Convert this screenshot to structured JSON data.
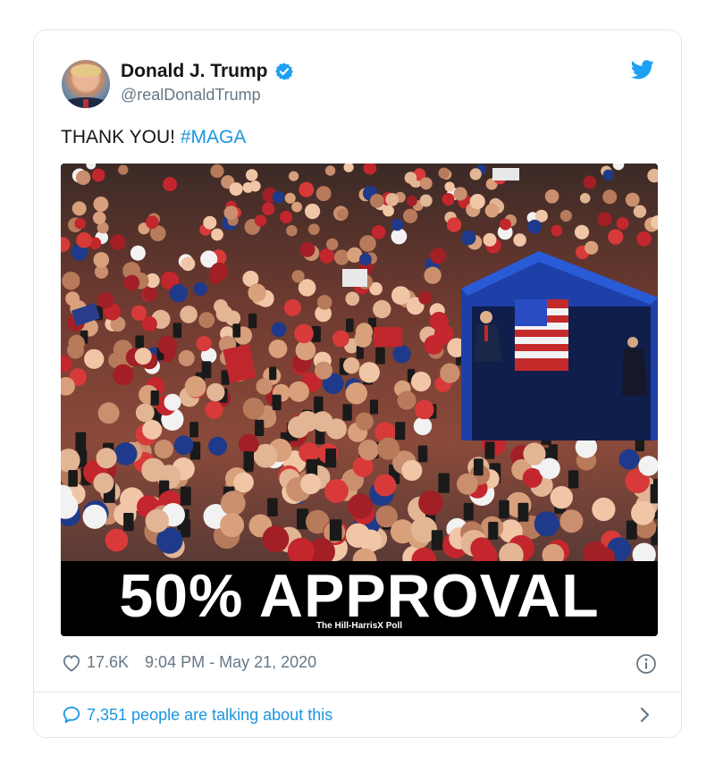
{
  "author": {
    "name": "Donald J. Trump",
    "handle": "@realDonaldTrump",
    "verified": true
  },
  "tweet": {
    "text_prefix": "THANK YOU! ",
    "hashtag": "#MAGA"
  },
  "media": {
    "headline": "50% APPROVAL",
    "source": "The Hill-HarrisX Poll"
  },
  "meta": {
    "likes": "17.6K",
    "timestamp": "9:04 PM - May 21, 2020"
  },
  "footer": {
    "conversation": "7,351 people are talking about this"
  },
  "icons": [
    "twitter-bird-icon",
    "verified-badge-icon",
    "heart-icon",
    "info-icon",
    "comment-bubble-icon",
    "chevron-right-icon"
  ],
  "colors": {
    "accent": "#1b95e0",
    "text": "#14171a",
    "muted": "#657786",
    "border": "#e1e8ed"
  }
}
